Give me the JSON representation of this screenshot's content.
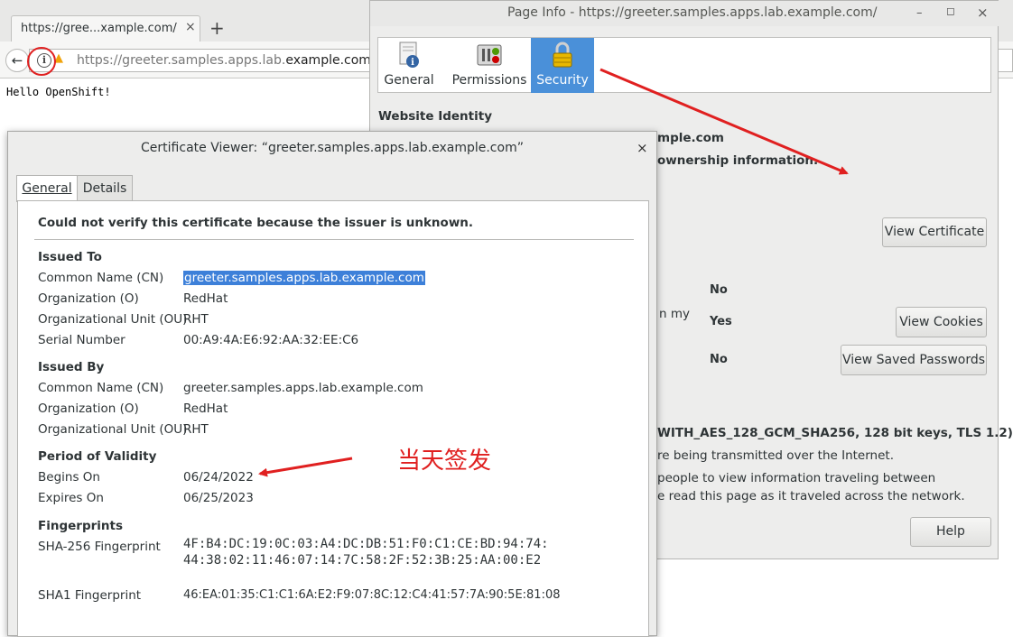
{
  "browser": {
    "tab_title": "https://gree...xample.com/",
    "tab_close": "×",
    "new_tab": "+",
    "back": "←",
    "url_prefix": "https://greeter.samples.apps.lab.",
    "url_host": "example.com",
    "page_text": "Hello OpenShift!"
  },
  "page_info": {
    "title": "Page Info - https://greeter.samples.apps.lab.example.com/",
    "window_buttons": [
      "–",
      "◻",
      "×"
    ],
    "tabs": [
      {
        "label": "General"
      },
      {
        "label": "Permissions"
      },
      {
        "label": "Security"
      }
    ],
    "website_identity_heading": "Website Identity",
    "identity_partial_website": "mple.com",
    "identity_partial_owner": "ownership information.",
    "view_certificate_label": "View Certificate",
    "privacy_partial_label": "n my",
    "privacy_values": [
      "No",
      "Yes",
      "No"
    ],
    "view_cookies_label": "View Cookies",
    "view_saved_passwords_label": "View Saved Passwords",
    "tech_partial_cipher": "WITH_AES_128_GCM_SHA256, 128 bit keys, TLS 1.2)",
    "tech_partial_line2": "re being transmitted over the Internet.",
    "tech_partial_line3": "people to view information traveling between",
    "tech_partial_line4": "e read this page as it traveled across the network.",
    "help_label": "Help"
  },
  "cert_viewer": {
    "title": "Certificate Viewer: “greeter.samples.apps.lab.example.com”",
    "close": "×",
    "tabs": [
      "General",
      "Details"
    ],
    "warning": "Could not verify this certificate because the issuer is unknown.",
    "issued_to": {
      "heading": "Issued To",
      "rows": [
        {
          "label": "Common Name (CN)",
          "value": "greeter.samples.apps.lab.example.com"
        },
        {
          "label": "Organization (O)",
          "value": "RedHat"
        },
        {
          "label": "Organizational Unit (OU)",
          "value": "RHT"
        },
        {
          "label": "Serial Number",
          "value": "00:A9:4A:E6:92:AA:32:EE:C6"
        }
      ]
    },
    "issued_by": {
      "heading": "Issued By",
      "rows": [
        {
          "label": "Common Name (CN)",
          "value": "greeter.samples.apps.lab.example.com"
        },
        {
          "label": "Organization (O)",
          "value": "RedHat"
        },
        {
          "label": "Organizational Unit (OU)",
          "value": "RHT"
        }
      ]
    },
    "validity": {
      "heading": "Period of Validity",
      "rows": [
        {
          "label": "Begins On",
          "value": "06/24/2022"
        },
        {
          "label": "Expires On",
          "value": "06/25/2023"
        }
      ]
    },
    "fingerprints": {
      "heading": "Fingerprints",
      "sha256_label": "SHA-256 Fingerprint",
      "sha256_line1": "4F:B4:DC:19:0C:03:A4:DC:DB:51:F0:C1:CE:BD:94:74:",
      "sha256_line2": "44:38:02:11:46:07:14:7C:58:2F:52:3B:25:AA:00:E2",
      "sha1_label": "SHA1 Fingerprint",
      "sha1_value": "46:EA:01:35:C1:C1:6A:E2:F9:07:8C:12:C4:41:57:7A:90:5E:81:08"
    }
  },
  "annotation": {
    "text": "当天签发",
    "color": "#e02020"
  },
  "colors": {
    "selection": "#3d80d9",
    "security_tab": "#4a90d9",
    "annotation_red": "#e02020"
  }
}
